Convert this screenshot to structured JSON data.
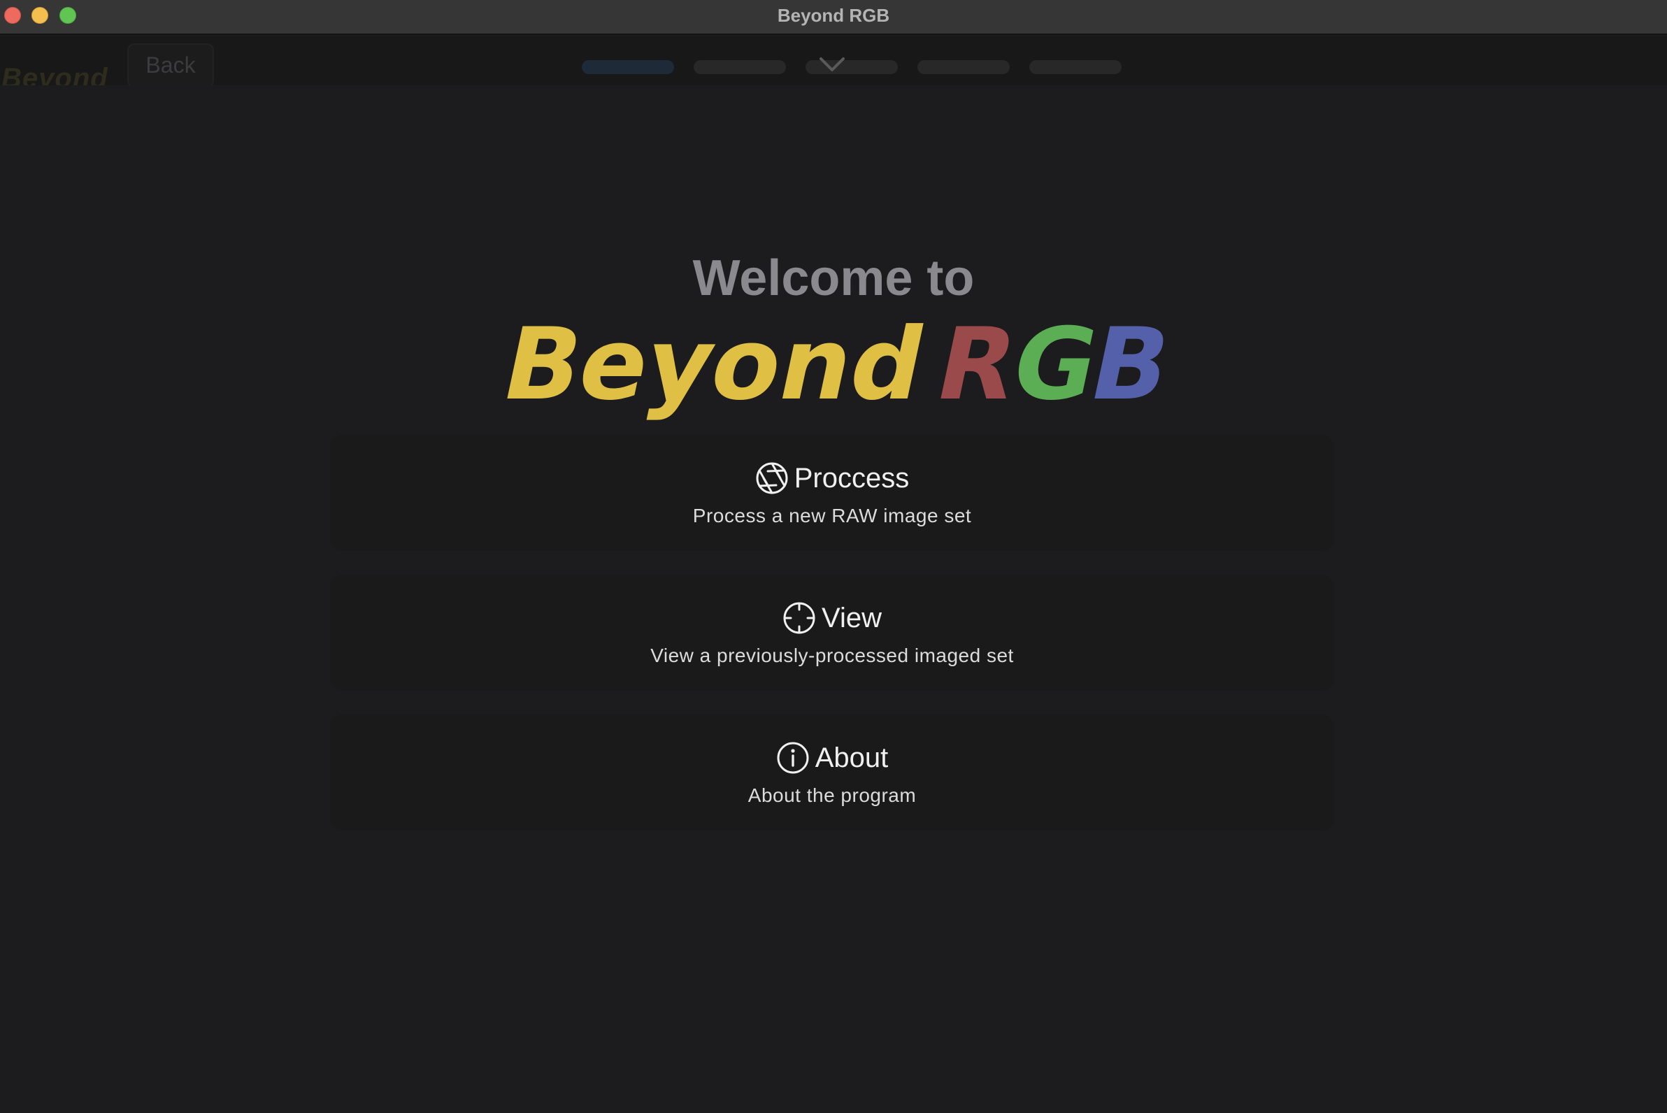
{
  "window": {
    "title": "Beyond RGB"
  },
  "toolbar": {
    "ghost_logo": "Beyond",
    "back_label": "Back",
    "steps_total": 5,
    "active_step": 1
  },
  "hero": {
    "welcome": "Welcome to",
    "brand_word": "Beyond",
    "brand_r": "R",
    "brand_g": "G",
    "brand_b": "B"
  },
  "menu": [
    {
      "title": "Proccess",
      "subtitle": "Process a new RAW image set",
      "icon": "aperture-icon"
    },
    {
      "title": "View",
      "subtitle": "View a previously-processed imaged set",
      "icon": "crosshair-icon"
    },
    {
      "title": "About",
      "subtitle": "About the program",
      "icon": "info-icon"
    }
  ],
  "colors": {
    "brand_yellow": "#e0bf45",
    "brand_red": "#9a4a4a",
    "brand_green": "#5cae54",
    "brand_blue": "#5460aa",
    "background": "#1c1c1e",
    "card": "#1a1a1b"
  }
}
